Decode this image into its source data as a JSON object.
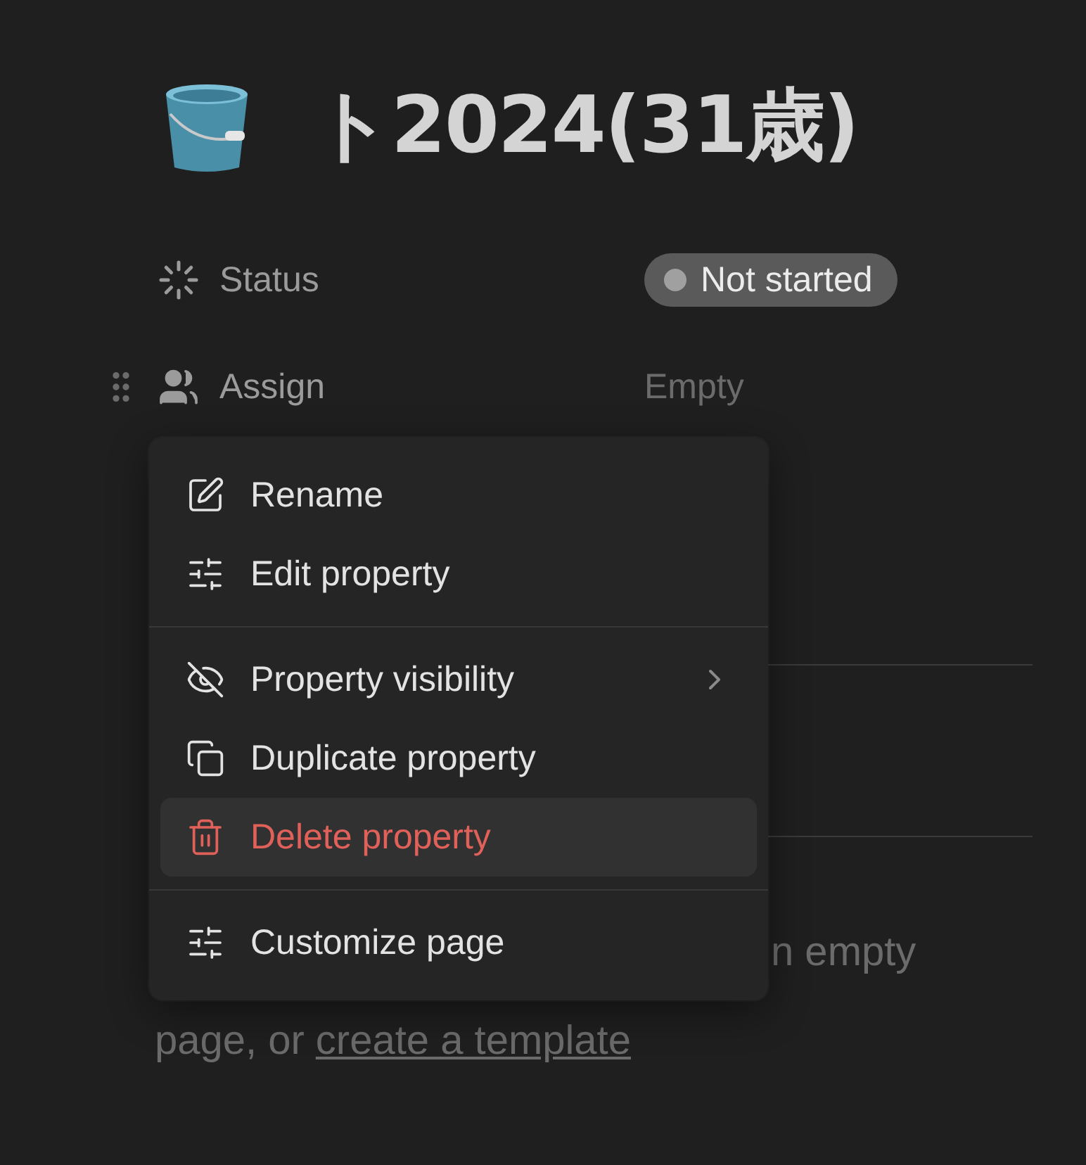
{
  "title": {
    "text": "ト2024(31歳)"
  },
  "properties": [
    {
      "kind": "status",
      "label": "Status",
      "value": "Not started",
      "color": "#a0a0a0",
      "hovered": false
    },
    {
      "kind": "person",
      "label": "Assign",
      "value": "Empty",
      "hovered": true
    }
  ],
  "background_text": {
    "line_1": "n empty",
    "line_2": "page, or",
    "link": "create a template"
  },
  "menu": {
    "groups": [
      [
        {
          "kind": "rename",
          "label": "Rename",
          "submenu": false,
          "danger": false,
          "selected": false
        },
        {
          "kind": "edit",
          "label": "Edit property",
          "submenu": false,
          "danger": false,
          "selected": false
        }
      ],
      [
        {
          "kind": "visibility",
          "label": "Property visibility",
          "submenu": true,
          "danger": false,
          "selected": false
        },
        {
          "kind": "duplicate",
          "label": "Duplicate property",
          "submenu": false,
          "danger": false,
          "selected": false
        },
        {
          "kind": "delete",
          "label": "Delete property",
          "submenu": false,
          "danger": true,
          "selected": true
        }
      ],
      [
        {
          "kind": "customize",
          "label": "Customize page",
          "submenu": false,
          "danger": false,
          "selected": false
        }
      ]
    ]
  }
}
